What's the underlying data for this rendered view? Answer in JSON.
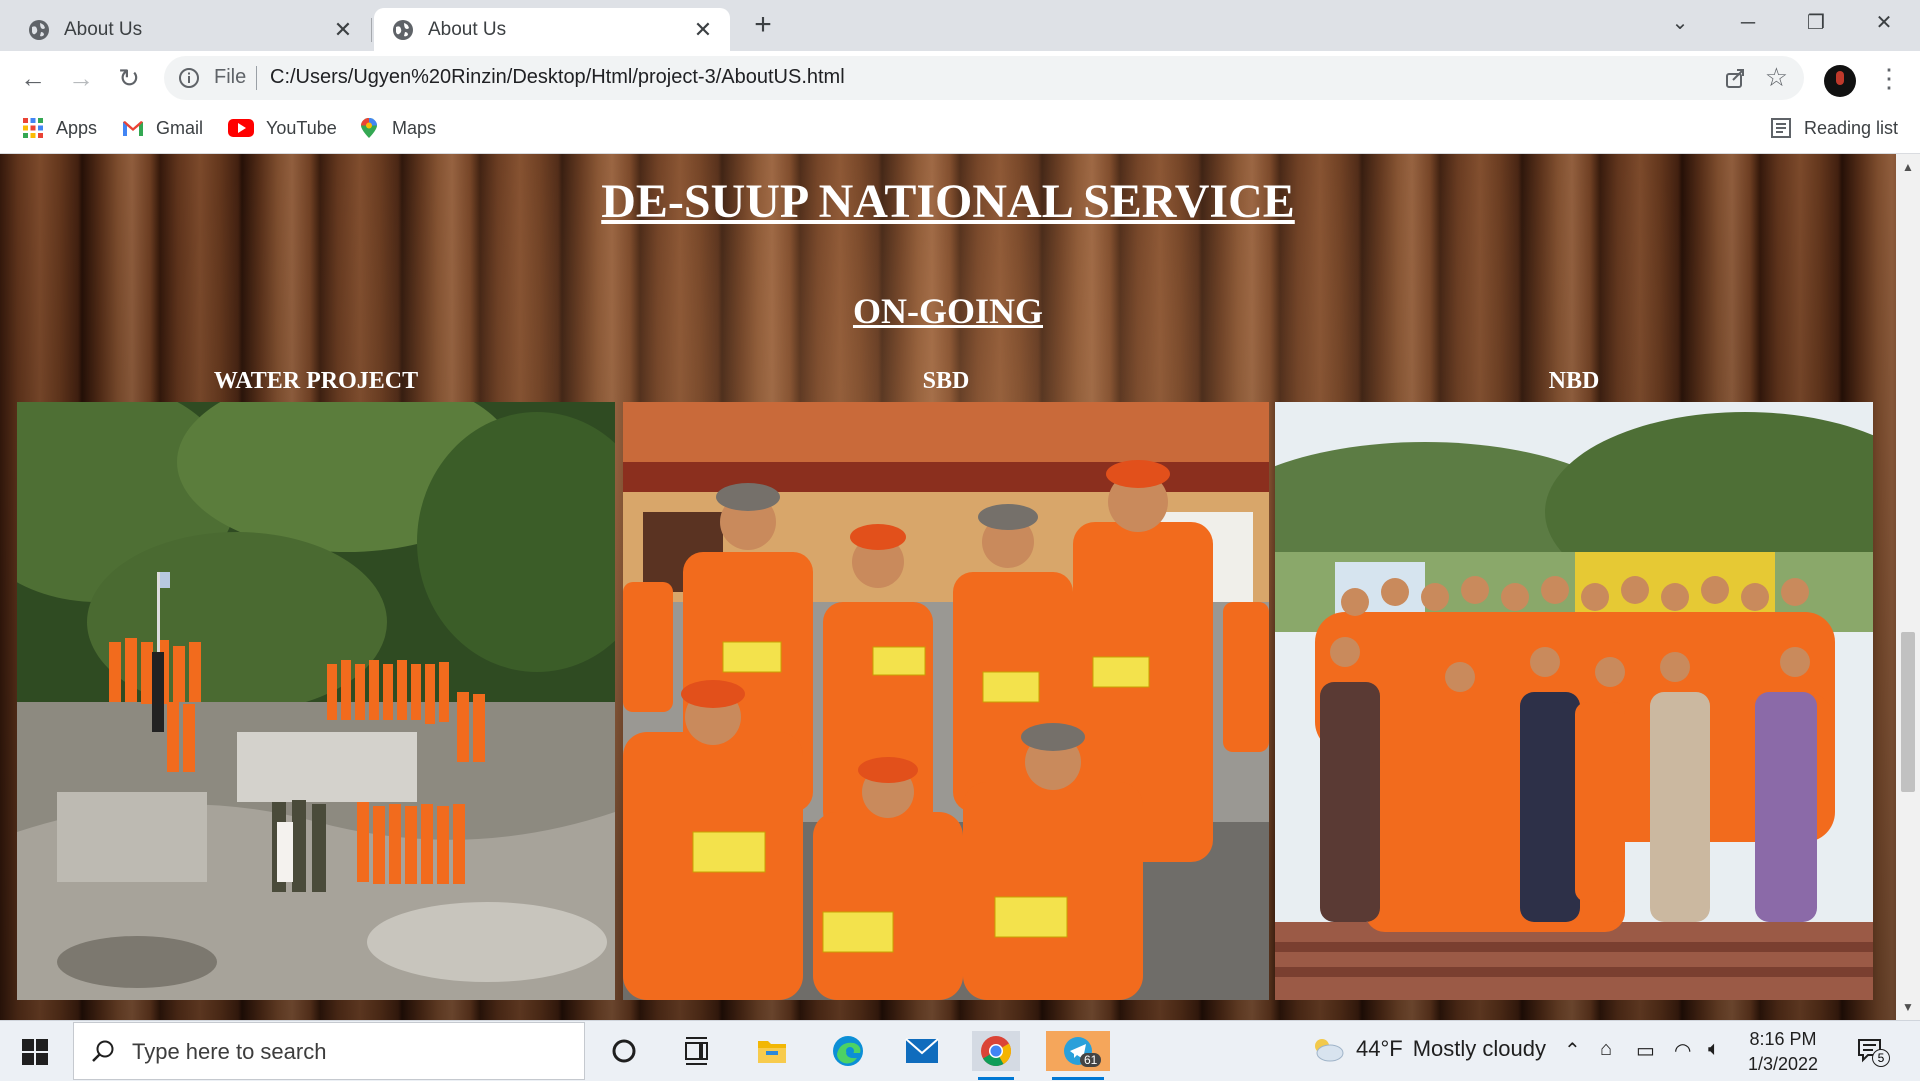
{
  "browser": {
    "tabs": [
      {
        "title": "About Us",
        "active": false
      },
      {
        "title": "About Us",
        "active": true
      }
    ],
    "address": {
      "scheme_label": "File",
      "url": "C:/Users/Ugyen%20Rinzin/Desktop/Html/project-3/AboutUS.html"
    },
    "bookmarks": [
      {
        "label": "Apps",
        "icon": "apps-grid-icon"
      },
      {
        "label": "Gmail",
        "icon": "gmail-icon"
      },
      {
        "label": "YouTube",
        "icon": "youtube-icon"
      },
      {
        "label": "Maps",
        "icon": "maps-icon"
      }
    ],
    "reading_list": "Reading list"
  },
  "page": {
    "title": "DE-SUUP NATIONAL SERVICE",
    "section": "ON-GOING",
    "cards": [
      {
        "label": "WATER PROJECT",
        "photo": "Group of volunteers in orange uniforms beside a water project site in a forested hillside"
      },
      {
        "label": "SBD",
        "photo": "Volunteers in orange uniforms holding yellow cards in front of a building"
      },
      {
        "label": "NBD",
        "photo": "Large group of volunteers in orange uniforms with officials on steps"
      }
    ]
  },
  "taskbar": {
    "search_placeholder": "Type here to search",
    "weather": {
      "temp": "44°F",
      "condition": "Mostly cloudy"
    },
    "time": "8:16 PM",
    "date": "1/3/2022",
    "telegram_badge": "61",
    "notification_count": "5"
  },
  "colors": {
    "wood_dark": "#3a1b0d",
    "wood_light": "#a06844",
    "uniform_orange": "#f26b1d",
    "taskbar_bg": "#ecf0f5"
  }
}
